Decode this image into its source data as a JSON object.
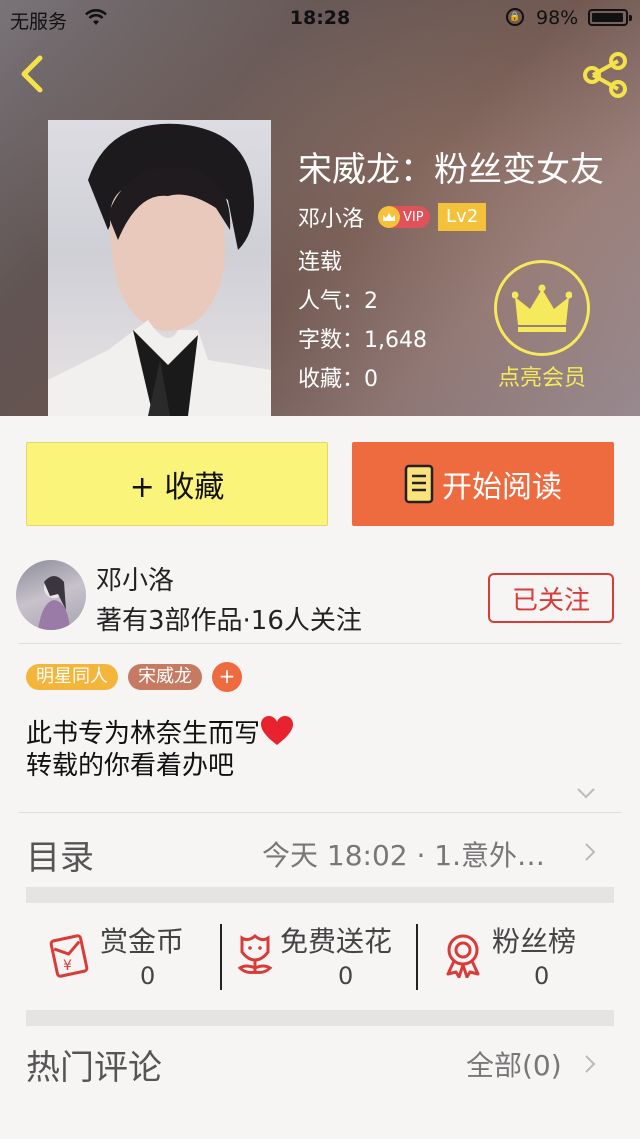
{
  "status_bar": {
    "carrier": "无服务",
    "time": "18:28",
    "battery": "98%"
  },
  "book": {
    "title": "宋威龙：粉丝变女友",
    "author": "邓小洛",
    "vip": "VIP",
    "level": "Lv2",
    "status": "连载",
    "popularity": "人气：2",
    "word_count": "字数：1,648",
    "favorites": "收藏：0"
  },
  "member": {
    "label": "点亮会员"
  },
  "actions": {
    "favorite": "+ 收藏",
    "read": "开始阅读"
  },
  "author_card": {
    "name": "邓小洛",
    "stats": "著有3部作品·16人关注",
    "follow": "已关注"
  },
  "tags": [
    {
      "label": "明星同人",
      "color": "#f3b53a"
    },
    {
      "label": "宋威龙",
      "color": "#c77a62"
    },
    {
      "label": "+",
      "color": "#ee6a3f"
    }
  ],
  "description": {
    "line1": "此书专为林奈生而写",
    "line2": "转载的你看着办吧"
  },
  "toc": {
    "label": "目录",
    "latest": "今天 18:02 · 1.意外…"
  },
  "stats": [
    {
      "label": "赏金币",
      "value": "0",
      "icon": "red-envelope-icon"
    },
    {
      "label": "免费送花",
      "value": "0",
      "icon": "flower-icon"
    },
    {
      "label": "粉丝榜",
      "value": "0",
      "icon": "medal-icon"
    }
  ],
  "comments": {
    "label": "热门评论",
    "all": "全部(0)"
  },
  "colors": {
    "accent_red": "#d93b38",
    "read_button": "#ee6a3f",
    "favorite_button": "#fbf47b",
    "member_yellow": "#f6e95b"
  }
}
